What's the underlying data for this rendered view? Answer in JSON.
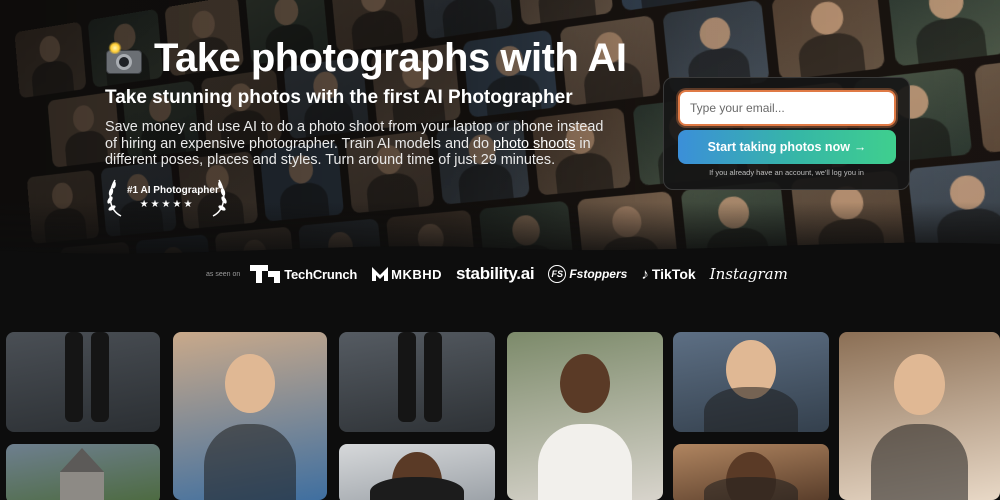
{
  "hero": {
    "title": "Take photographs with AI",
    "subtitle": "Take stunning photos with the first AI Photographer",
    "description_pre": "Save money and use AI to do a photo shoot from your laptop or phone instead of hiring an expensive photographer. Train AI models and do ",
    "description_link": "photo shoots",
    "description_post": " in different poses, places and styles. Turn around time of just 29 minutes.",
    "award_label": "#1 AI Photographer",
    "award_stars": "★★★★★"
  },
  "signup": {
    "email_placeholder": "Type your email...",
    "cta_label": "Start taking photos now",
    "cta_arrow": "→",
    "note": "If you already have an account, we'll log you in"
  },
  "press": {
    "as_seen_on": "as seen on",
    "brands": {
      "techcrunch": "TechCrunch",
      "mkbhd": "MKBHD",
      "stability": "stability.ai",
      "fstoppers_mark": "FS",
      "fstoppers": "Fstoppers",
      "tiktok_mark": "♪",
      "tiktok": "TikTok",
      "instagram": "Instagram"
    }
  },
  "icons": {
    "camera": "camera-with-flash-icon",
    "laurel": "laurel-icon"
  },
  "colors": {
    "cta_gradient_start": "#3b8fd9",
    "cta_gradient_end": "#3fcf8e",
    "input_focus": "#e07a45",
    "page_bg": "#0d0d0d"
  }
}
